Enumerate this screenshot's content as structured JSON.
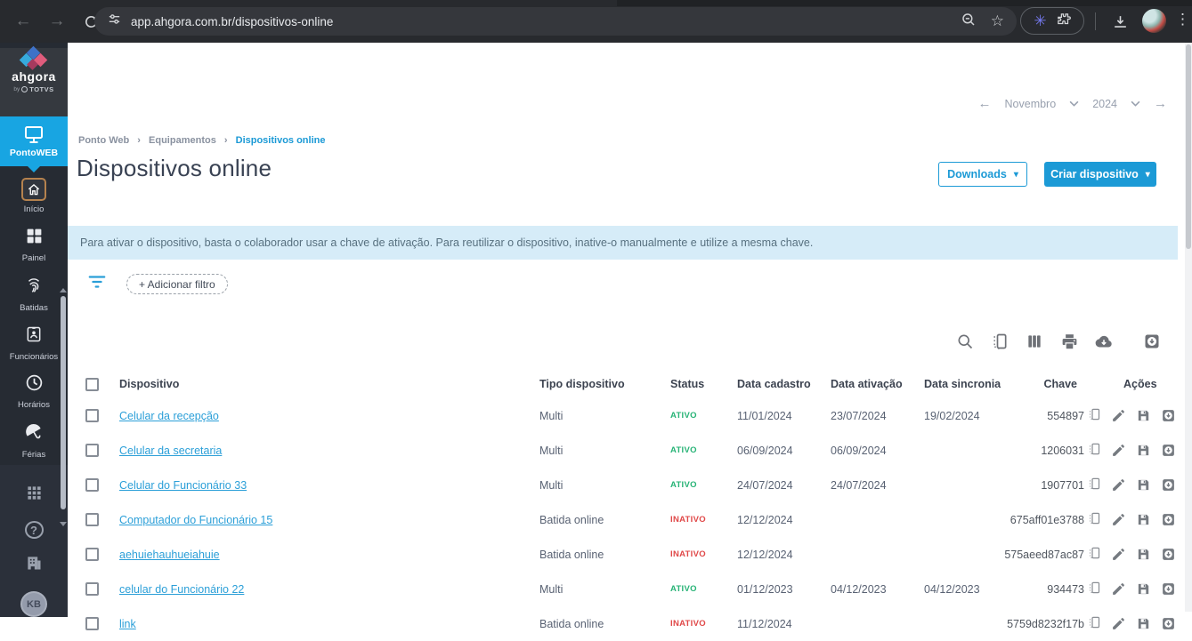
{
  "browser": {
    "url": "app.ahgora.com.br/dispositivos-online"
  },
  "icons": {
    "back": "←",
    "forward": "→",
    "star": "☆",
    "kebab": "⋮",
    "burst": "✳",
    "help": "?",
    "caret": "▾",
    "crumb_sep": "›"
  },
  "sidebar": {
    "logo": "ahgora",
    "logo_by": "by",
    "logo_totvs": "TOTVS",
    "product": "PontoWEB",
    "items": [
      {
        "label": "Início"
      },
      {
        "label": "Painel"
      },
      {
        "label": "Batidas"
      },
      {
        "label": "Funcionários"
      },
      {
        "label": "Horários"
      },
      {
        "label": "Férias"
      }
    ],
    "avatar_initials": "KB"
  },
  "period_nav": {
    "month": "Novembro",
    "year": "2024"
  },
  "breadcrumb": {
    "items": [
      "Ponto Web",
      "Equipamentos",
      "Dispositivos online"
    ]
  },
  "page": {
    "title": "Dispositivos online"
  },
  "header_actions": {
    "downloads": "Downloads",
    "create": "Criar dispositivo"
  },
  "banner": {
    "text": "Para ativar o dispositivo, basta o colaborador usar a chave de ativação. Para reutilizar o dispositivo, inative-o manualmente e utilize a mesma chave."
  },
  "filter": {
    "add_label": "+ Adicionar filtro"
  },
  "table": {
    "headers": [
      "Dispositivo",
      "Tipo dispositivo",
      "Status",
      "Data cadastro",
      "Data ativação",
      "Data sincronia",
      "Chave",
      "Ações"
    ],
    "rows": [
      {
        "name": "Celular da recepção",
        "type": "Multi",
        "status": "ATIVO",
        "cadastro": "11/01/2024",
        "ativacao": "23/07/2024",
        "sincronia": "19/02/2024",
        "chave": "554897"
      },
      {
        "name": "Celular da secretaria",
        "type": "Multi",
        "status": "ATIVO",
        "cadastro": "06/09/2024",
        "ativacao": "06/09/2024",
        "sincronia": "",
        "chave": "1206031"
      },
      {
        "name": "Celular do Funcionário 33",
        "type": "Multi",
        "status": "ATIVO",
        "cadastro": "24/07/2024",
        "ativacao": "24/07/2024",
        "sincronia": "",
        "chave": "1907701"
      },
      {
        "name": "Computador do Funcionário 15",
        "type": "Batida online",
        "status": "INATIVO",
        "cadastro": "12/12/2024",
        "ativacao": "",
        "sincronia": "",
        "chave": "675aff01e3788"
      },
      {
        "name": "aehuiehauhueiahuie",
        "type": "Batida online",
        "status": "INATIVO",
        "cadastro": "12/12/2024",
        "ativacao": "",
        "sincronia": "",
        "chave": "575aeed87ac87"
      },
      {
        "name": "celular do Funcionário 22",
        "type": "Multi",
        "status": "ATIVO",
        "cadastro": "01/12/2023",
        "ativacao": "04/12/2023",
        "sincronia": "04/12/2023",
        "chave": "934473"
      },
      {
        "name": "link",
        "type": "Batida online",
        "status": "INATIVO",
        "cadastro": "11/12/2024",
        "ativacao": "",
        "sincronia": "",
        "chave": "5759d8232f17b"
      }
    ]
  },
  "colors": {
    "accent_blue": "#1c9ad6",
    "sidebar_blue": "#18a5e2",
    "status_active": "#27b376",
    "status_inactive": "#e04848",
    "banner_bg": "#d6ecf8"
  }
}
